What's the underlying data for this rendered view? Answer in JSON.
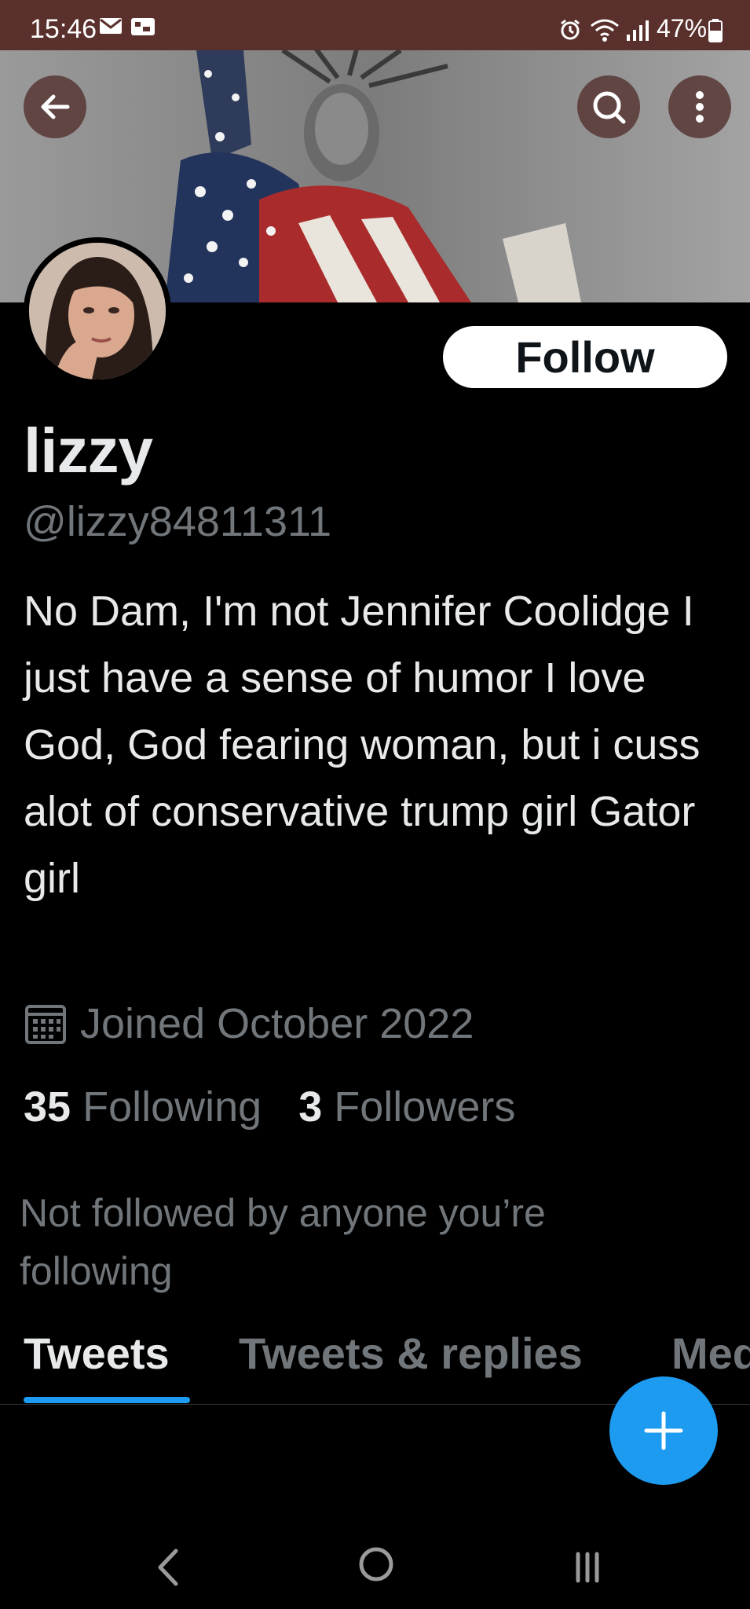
{
  "status_bar": {
    "time": "15:46",
    "battery": "47%"
  },
  "header": {
    "back_label": "back",
    "search_label": "search",
    "more_label": "more"
  },
  "profile": {
    "follow_label": "Follow",
    "display_name": "lizzy",
    "handle": "@lizzy84811311",
    "bio": "No Dam, I'm not Jennifer Coolidge I just have a sense of humor I love God, God fearing woman, but i cuss alot of conservative trump girl Gator girl",
    "joined": "Joined October 2022",
    "following_count": "35",
    "following_label": "Following",
    "followers_count": "3",
    "followers_label": "Followers",
    "mutual_note": "Not followed by anyone you’re following"
  },
  "tabs": [
    {
      "label": "Tweets",
      "active": true
    },
    {
      "label": "Tweets & replies",
      "active": false
    },
    {
      "label": "Media",
      "active": false
    }
  ],
  "colors": {
    "accent": "#1d9bf0",
    "status_bar": "#5a302c",
    "secondary_text": "#71767b"
  }
}
